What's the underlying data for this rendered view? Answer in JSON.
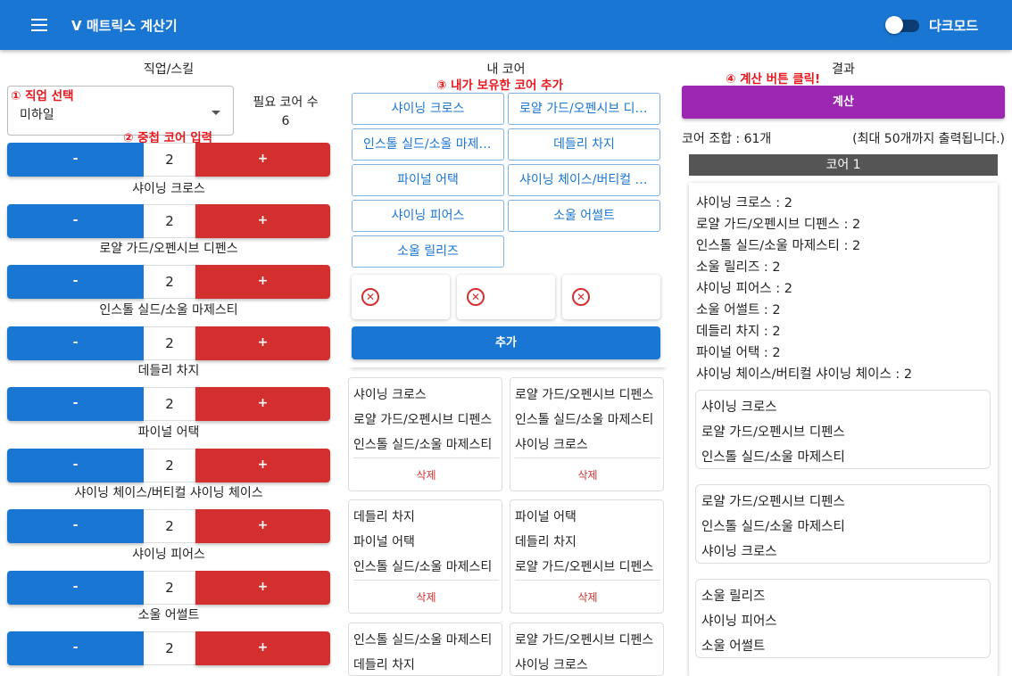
{
  "app": {
    "title": "V 매트릭스 계산기",
    "dark_mode_label": "다크모드"
  },
  "left": {
    "header": "직업/스킬",
    "annotation_select": "① 직업 선택",
    "annotation_dup": "② 중첩 코어 입력",
    "job_value": "미하일",
    "required_label": "필요 코어 수",
    "required_value": "6",
    "minus_label": "-",
    "plus_label": "+",
    "skills": [
      {
        "count": "2",
        "label": "샤이닝 크로스"
      },
      {
        "count": "2",
        "label": "로얄 가드/오펜시브 디펜스"
      },
      {
        "count": "2",
        "label": "인스톨 실드/소울 마제스티"
      },
      {
        "count": "2",
        "label": "데들리 차지"
      },
      {
        "count": "2",
        "label": "파이널 어택"
      },
      {
        "count": "2",
        "label": "샤이닝 체이스/버티컬 샤이닝 체이스"
      },
      {
        "count": "2",
        "label": "샤이닝 피어스"
      },
      {
        "count": "2",
        "label": "소울 어썰트"
      },
      {
        "count": "2",
        "label": ""
      }
    ]
  },
  "middle": {
    "header": "내 코어",
    "annotation": "③ 내가 보유한 코어 추가",
    "core_buttons": [
      "샤이닝 크로스",
      "로얄 가드/오펜시브 디펜스",
      "인스톨 실드/소울 마제스티",
      "데들리 차지",
      "파이널 어택",
      "샤이닝 체이스/버티컬 샤이닝 체이스",
      "샤이닝 피어스",
      "소울 어썰트",
      "소울 릴리즈"
    ],
    "clear_icon_glyph": "✕",
    "add_button": "추가",
    "delete_label": "삭제",
    "owned_cores": [
      [
        "샤이닝 크로스",
        "로얄 가드/오펜시브 디펜스",
        "인스톨 실드/소울 마제스티"
      ],
      [
        "로얄 가드/오펜시브 디펜스",
        "인스톨 실드/소울 마제스티",
        "샤이닝 크로스"
      ],
      [
        "데들리 차지",
        "파이널 어택",
        "인스톨 실드/소울 마제스티"
      ],
      [
        "파이널 어택",
        "데들리 차지",
        "로얄 가드/오펜시브 디펜스"
      ],
      [
        "인스톨 실드/소울 마제스티",
        "데들리 차지",
        ""
      ],
      [
        "로얄 가드/오펜시브 디펜스",
        "샤이닝 크로스",
        ""
      ]
    ]
  },
  "right": {
    "header": "결과",
    "annotation": "④ 계산 버튼 클릭!",
    "calc_button": "계산",
    "combo_count": "코어 조합 : 61개",
    "max_note": "(최대 50개까지 출력됩니다.)",
    "combo_title": "코어 1",
    "summary": [
      "샤이닝 크로스 : 2",
      "로얄 가드/오펜시브 디펜스 : 2",
      "인스톨 실드/소울 마제스티 : 2",
      "소울 릴리즈 : 2",
      "샤이닝 피어스 : 2",
      "소울 어썰트 : 2",
      "데들리 차지 : 2",
      "파이널 어택 : 2",
      "샤이닝 체이스/버티컬 샤이닝 체이스 : 2"
    ],
    "result_cores": [
      [
        "샤이닝 크로스",
        "로얄 가드/오펜시브 디펜스",
        "인스톨 실드/소울 마제스티"
      ],
      [
        "로얄 가드/오펜시브 디펜스",
        "인스톨 실드/소울 마제스티",
        "샤이닝 크로스"
      ],
      [
        "소울 릴리즈",
        "샤이닝 피어스",
        "소울 어썰트"
      ]
    ]
  },
  "colors": {
    "primary": "#1976d2",
    "danger": "#d32f2f",
    "purple": "#9c27b0",
    "annotation": "#e8181f"
  }
}
